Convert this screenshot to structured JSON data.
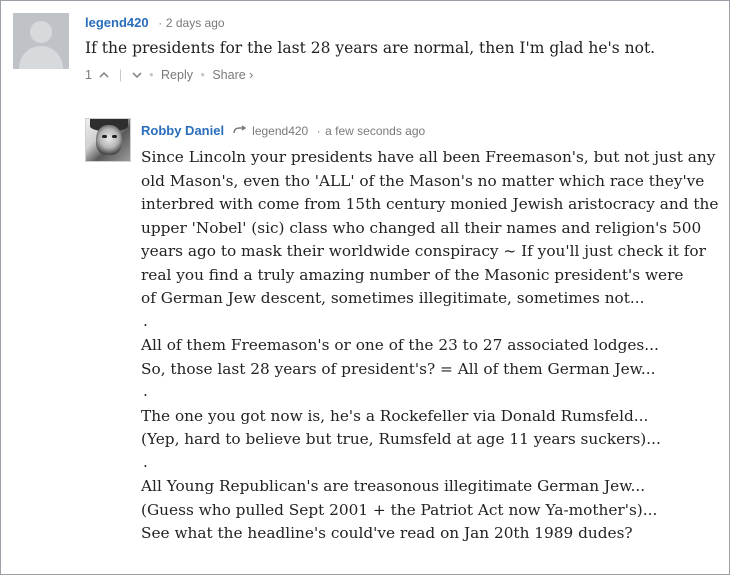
{
  "comment1": {
    "author": "legend420",
    "timestamp": "2 days ago",
    "text": "If the presidents for the last 28 years are normal, then I'm glad he's not.",
    "actions": {
      "upvotes": "1",
      "up_icon": "chevron-up-icon",
      "down_icon": "chevron-down-icon",
      "reply": "Reply",
      "share": "Share ›"
    }
  },
  "comment2": {
    "author": "Robby Daniel",
    "reply_to": "legend420",
    "timestamp": "a few seconds ago",
    "lines": [
      "Since Lincoln your presidents have all been Freemason's, but not just any",
      "old Mason's, even tho 'ALL' of the Mason's no matter which race they've",
      "interbred with come from 15th century monied Jewish aristocracy and the",
      "upper 'Nobel' (sic) class who changed all their names and religion's 500",
      "years ago to mask their worldwide conspiracy ~ If you'll just check it for",
      "real you find a truly amazing number of the Masonic president's were",
      "of German Jew descent, sometimes illegitimate, sometimes not...",
      ".",
      "All of them Freemason's or one of the 23 to 27 associated lodges...",
      "So, those last 28 years of president's? = All of them German Jew...",
      ".",
      "The one you got now is, he's a Rockefeller via Donald Rumsfeld...",
      "(Yep, hard to believe but true, Rumsfeld at age 11 years suckers)...",
      ".",
      "All Young Republican's are treasonous illegitimate German Jew...",
      "(Guess who pulled Sept 2001 + the Patriot Act now Ya-mother's)...",
      "See what the headline's could've read on Jan 20th 1989 dudes?"
    ]
  }
}
